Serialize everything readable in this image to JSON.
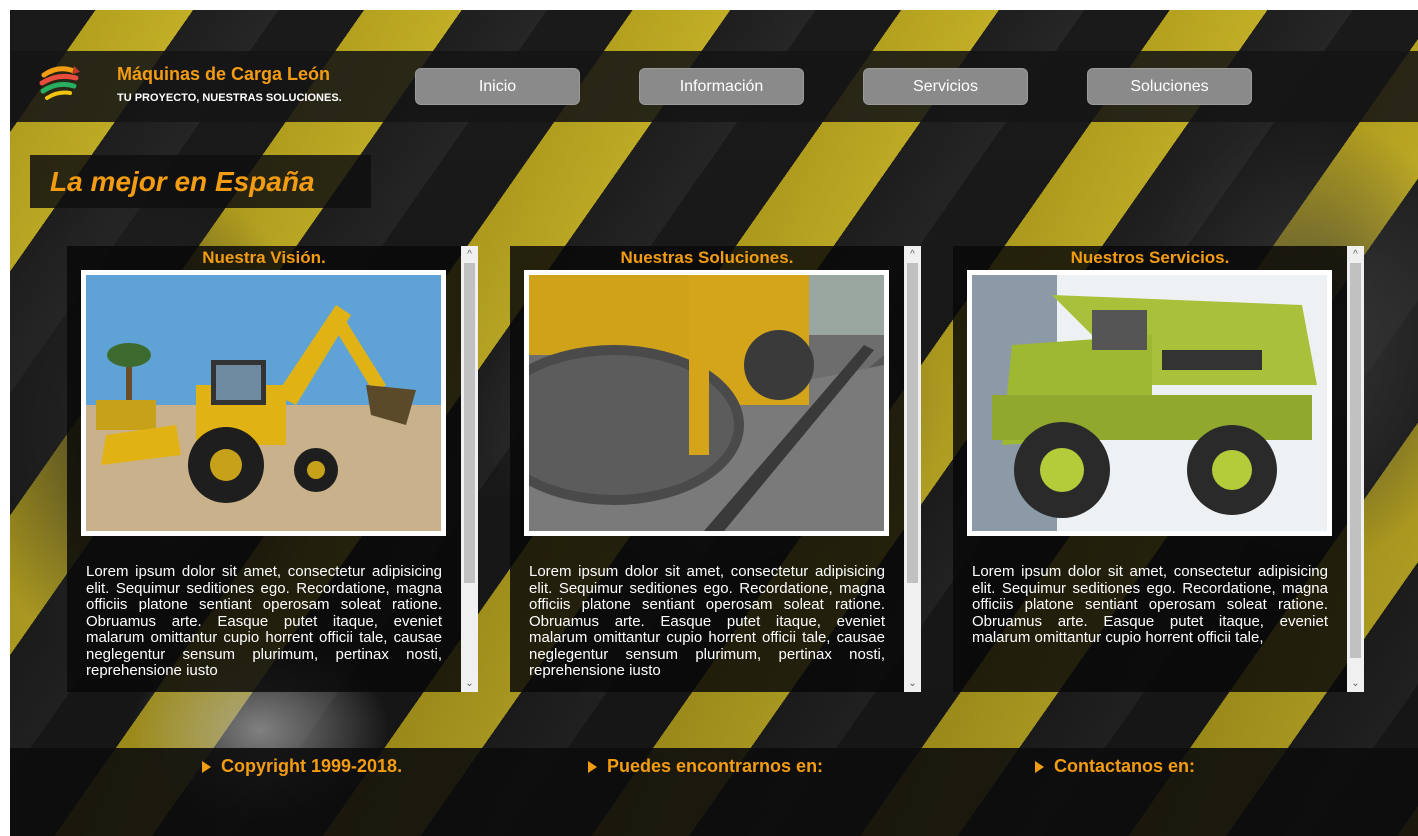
{
  "brand": {
    "title": "Máquinas de Carga León",
    "tagline": "TU PROYECTO, NUESTRAS SOLUCIONES."
  },
  "nav": {
    "items": [
      {
        "label": "Inicio"
      },
      {
        "label": "Información"
      },
      {
        "label": "Servicios"
      },
      {
        "label": "Soluciones"
      }
    ]
  },
  "hero": {
    "title": "La mejor en España"
  },
  "cards": [
    {
      "title": "Nuestra Visión.",
      "image": "backhoe-loader",
      "text": "Lorem ipsum dolor sit amet, consectetur adipisicing elit. Sequimur seditiones ego. Recordatione, magna officiis platone sentiant operosam soleat ratione. Obruamus arte. Easque putet itaque, eveniet malarum omittantur cupio horrent officii tale, causae neglegentur sensum plurimum, pertinax nosti, reprehensione iusto"
    },
    {
      "title": "Nuestras Soluciones.",
      "image": "road-roller",
      "text": "Lorem ipsum dolor sit amet, consectetur adipisicing elit. Sequimur seditiones ego. Recordatione, magna officiis platone sentiant operosam soleat ratione. Obruamus arte. Easque putet itaque, eveniet malarum omittantur cupio horrent officii tale, causae neglegentur sensum plurimum, pertinax nosti, reprehensione iusto"
    },
    {
      "title": "Nuestros Servicios.",
      "image": "dump-truck",
      "text": "Lorem ipsum dolor sit amet, consectetur adipisicing elit. Sequimur seditiones ego. Recordatione, magna officiis platone sentiant operosam soleat ratione. Obruamus arte. Easque putet itaque, eveniet malarum omittantur cupio horrent officii tale,"
    }
  ],
  "footer": {
    "items": [
      {
        "label": "Copyright 1999-2018."
      },
      {
        "label": "Puedes encontrarnos en:"
      },
      {
        "label": "Contactanos en:"
      }
    ]
  },
  "colors": {
    "accent": "#f39c12",
    "nav_button": "#8a8a8a",
    "panel": "#080808"
  }
}
